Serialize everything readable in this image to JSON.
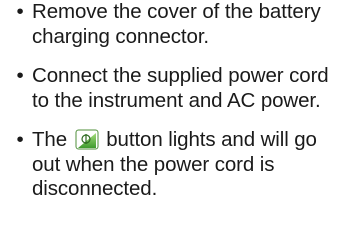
{
  "instructions": {
    "bullet_glyph": "•",
    "steps": [
      {
        "text": "Remove the cover of the battery charging connector."
      },
      {
        "text": "Connect the supplied power cord to the instrument and AC power."
      },
      {
        "text_before_icon": "The",
        "icon": "power-button-icon",
        "icon_color": "#4caf50",
        "text_after_icon": "button lights and will go out when the power cord is disconnected."
      }
    ]
  }
}
